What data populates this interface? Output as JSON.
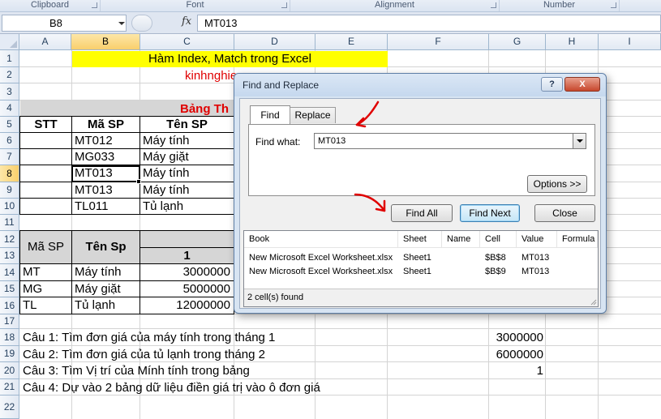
{
  "ribbon": {
    "groups": [
      "Clipboard",
      "Font",
      "Alignment",
      "Number"
    ]
  },
  "formula_bar": {
    "name_box": "B8",
    "fx": "fx",
    "formula": "MT013"
  },
  "columns": [
    "A",
    "B",
    "C",
    "D",
    "E",
    "F",
    "G",
    "H",
    "I"
  ],
  "rows": [
    "1",
    "2",
    "3",
    "4",
    "5",
    "6",
    "7",
    "8",
    "9",
    "10",
    "11",
    "12",
    "13",
    "14",
    "15",
    "16",
    "17",
    "18",
    "19",
    "20",
    "21",
    "22"
  ],
  "sheet": {
    "title": "Hàm Index, Match trong Excel",
    "subtitle": "kinhnghie",
    "table1_title": "Bảng Th",
    "table1_headers": [
      "STT",
      "Mã SP",
      "Tên SP"
    ],
    "table1_rows": [
      {
        "code": "MT012",
        "name": "Máy tính"
      },
      {
        "code": "MG033",
        "name": "Máy giặt"
      },
      {
        "code": "MT013",
        "name": "Máy tính"
      },
      {
        "code": "MT013",
        "name": "Máy tính"
      },
      {
        "code": "TL011",
        "name": "Tủ lạnh"
      }
    ],
    "table2_header_code": "Mã SP",
    "table2_header_name": "Tên Sp",
    "table2_month": "1",
    "table2_rows": [
      {
        "code": "MT",
        "name": "Máy tính",
        "price": "3000000"
      },
      {
        "code": "MG",
        "name": "Máy giặt",
        "price": "5000000"
      },
      {
        "code": "TL",
        "name": "Tủ lạnh",
        "price": "12000000"
      }
    ],
    "questions": [
      {
        "text": "Câu 1: Tìm đơn giá của máy tính trong tháng 1",
        "answer": "3000000"
      },
      {
        "text": "Câu 2: Tìm đơn giá của tủ lạnh trong tháng 2",
        "answer": "6000000"
      },
      {
        "text": "Câu 3: Tìm Vị trí của Mính tính trong bảng",
        "answer": "1"
      },
      {
        "text": "Câu 4: Dự vào 2 bảng dữ liệu điền giá trị vào ô đơn giá",
        "answer": ""
      }
    ]
  },
  "dialog": {
    "title": "Find and Replace",
    "help_label": "?",
    "close_label": "X",
    "tabs": [
      "Find",
      "Replace"
    ],
    "find_label": "Find what:",
    "find_value": "MT013",
    "options_label": "Options >>",
    "find_all_label": "Find All",
    "find_next_label": "Find Next",
    "close_button_label": "Close",
    "results_headers": [
      "Book",
      "Sheet",
      "Name",
      "Cell",
      "Value",
      "Formula"
    ],
    "results_rows": [
      {
        "book": "New Microsoft Excel Worksheet.xlsx",
        "sheet": "Sheet1",
        "name": "",
        "cell": "$B$8",
        "value": "MT013",
        "formula": ""
      },
      {
        "book": "New Microsoft Excel Worksheet.xlsx",
        "sheet": "Sheet1",
        "name": "",
        "cell": "$B$9",
        "value": "MT013",
        "formula": ""
      }
    ],
    "status": "2 cell(s) found"
  },
  "colors": {
    "title_fill": "#ffff00",
    "red_text": "#e00000",
    "annotation_arrow": "#e00000",
    "header_fill": "#d6d6d6"
  }
}
